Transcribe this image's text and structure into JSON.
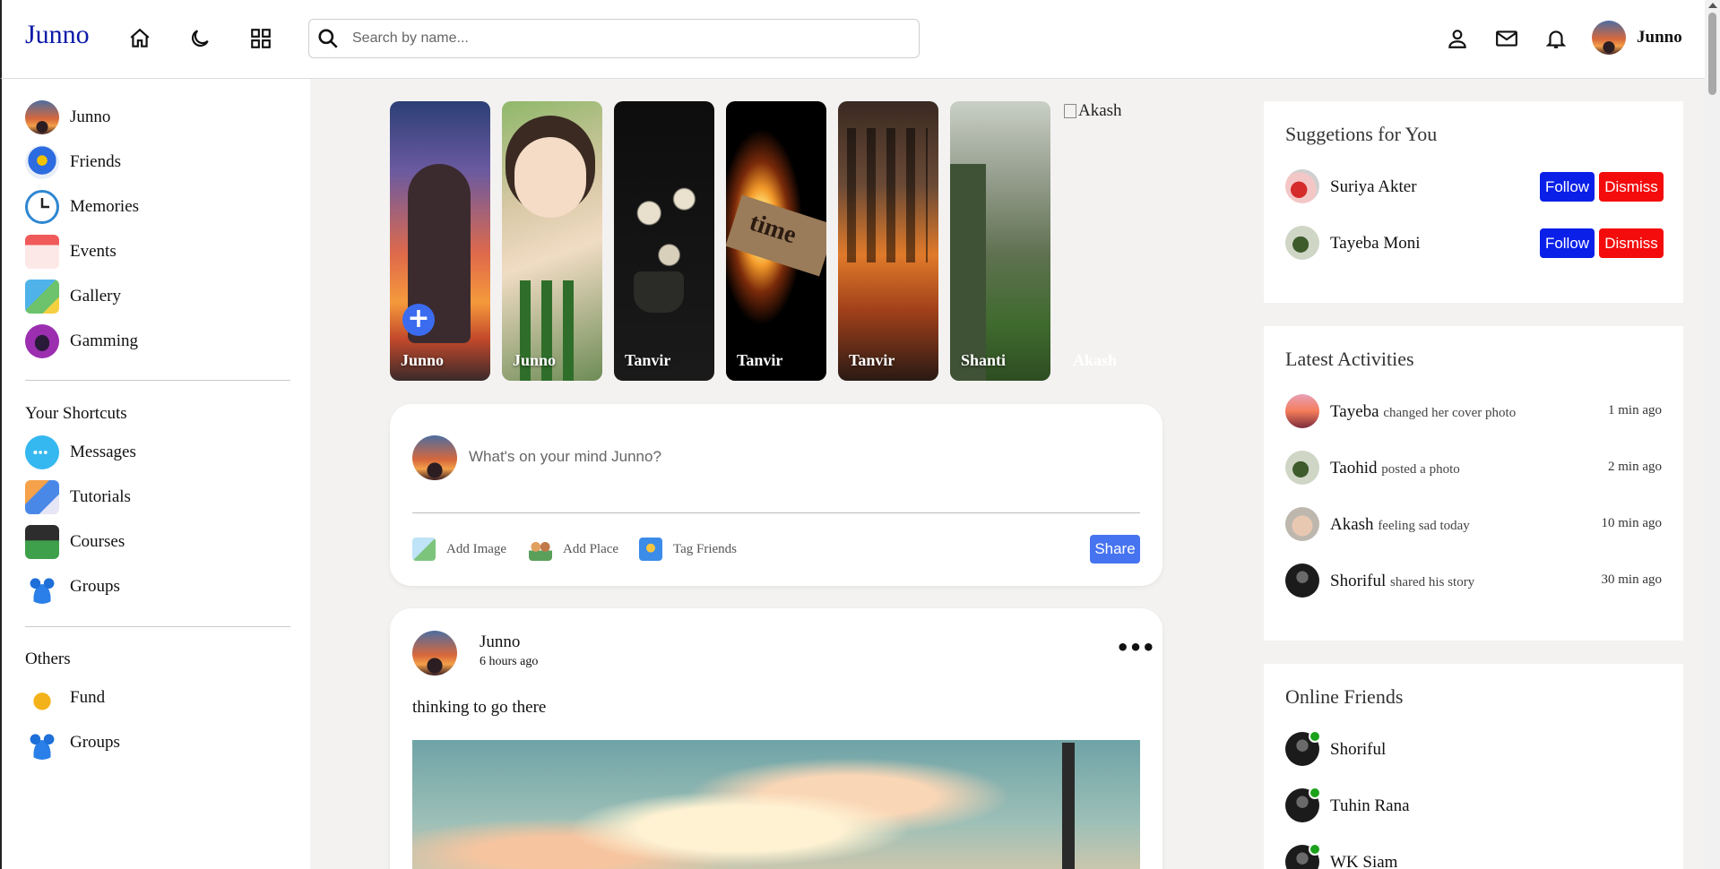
{
  "topbar": {
    "brand": "Junno",
    "search_placeholder": "Search by name...",
    "user_name": "Junno",
    "icons": [
      "home-icon",
      "moon-icon",
      "grid-icon",
      "user-icon",
      "mail-icon",
      "bell-icon"
    ]
  },
  "sidebar": {
    "main": [
      {
        "label": "Junno",
        "icon": "avatar"
      },
      {
        "label": "Friends",
        "icon": "friends-icon"
      },
      {
        "label": "Memories",
        "icon": "clock-icon"
      },
      {
        "label": "Events",
        "icon": "calendar-icon"
      },
      {
        "label": "Gallery",
        "icon": "gallery-icon"
      },
      {
        "label": "Gamming",
        "icon": "gamepad-icon"
      }
    ],
    "shortcuts_title": "Your Shortcuts",
    "shortcuts": [
      {
        "label": "Messages",
        "icon": "chat-bubble-icon"
      },
      {
        "label": "Tutorials",
        "icon": "video-tutorial-icon"
      },
      {
        "label": "Courses",
        "icon": "graduation-cap-icon"
      },
      {
        "label": "Groups",
        "icon": "group-icon"
      }
    ],
    "others_title": "Others",
    "others": [
      {
        "label": "Fund",
        "icon": "money-bag-icon"
      },
      {
        "label": "Groups",
        "icon": "group-icon"
      }
    ]
  },
  "stories": [
    {
      "name": "Junno"
    },
    {
      "name": "Junno"
    },
    {
      "name": "Tanvir"
    },
    {
      "name": "Tanvir",
      "image_text": "time"
    },
    {
      "name": "Tanvir"
    },
    {
      "name": "Shanti"
    },
    {
      "name": "Akash",
      "alt": "Akash"
    }
  ],
  "composer": {
    "placeholder": "What's on your mind Junno?",
    "add_image": "Add Image",
    "add_place": "Add Place",
    "tag_friends": "Tag Friends",
    "share": "Share"
  },
  "post": {
    "author": "Junno",
    "time": "6 hours ago",
    "text": "thinking to go there",
    "menu": "•••"
  },
  "suggestions": {
    "title": "Suggetions for You",
    "follow_label": "Follow",
    "dismiss_label": "Dismiss",
    "items": [
      {
        "name": "Suriya Akter"
      },
      {
        "name": "Tayeba Moni"
      }
    ]
  },
  "activities": {
    "title": "Latest Activities",
    "items": [
      {
        "name": "Tayeba",
        "action": "changed her cover photo",
        "time": "1 min ago"
      },
      {
        "name": "Taohid",
        "action": "posted a photo",
        "time": "2 min ago"
      },
      {
        "name": "Akash",
        "action": "feeling sad today",
        "time": "10 min ago"
      },
      {
        "name": "Shoriful",
        "action": "shared his story",
        "time": "30 min ago"
      }
    ]
  },
  "online": {
    "title": "Online Friends",
    "items": [
      {
        "name": "Shoriful"
      },
      {
        "name": "Tuhin Rana"
      },
      {
        "name": "WK Siam"
      }
    ]
  },
  "colors": {
    "brand": "#0b1aa8",
    "follow": "#0a1fe8",
    "dismiss": "#f40b0b",
    "share": "#4673f0",
    "online": "#1aa21a"
  }
}
